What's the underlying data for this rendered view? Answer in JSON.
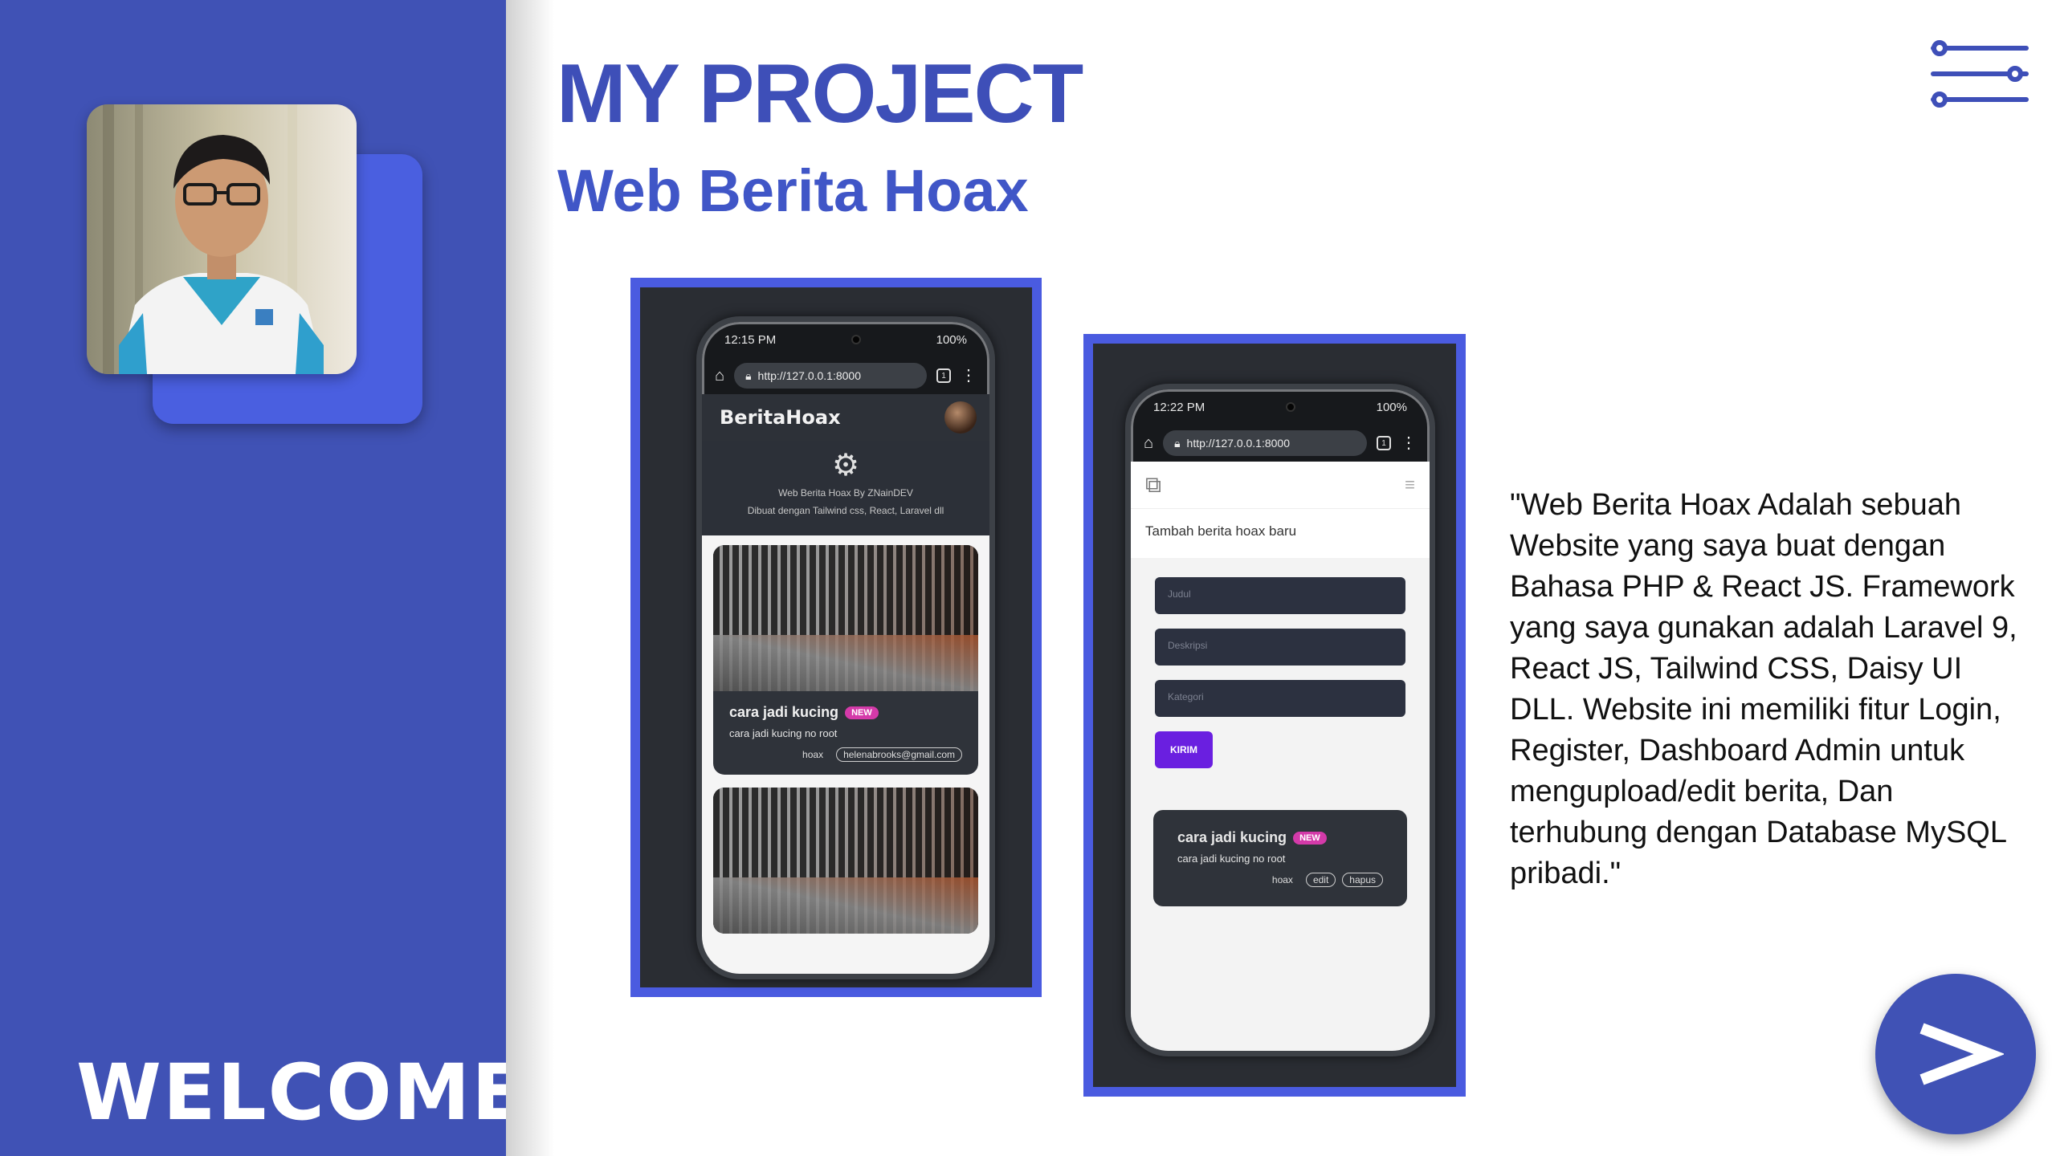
{
  "sidebar": {
    "welcome": "WELCOME"
  },
  "header": {
    "title": "MY PROJECT",
    "subtitle": "Web Berita Hoax"
  },
  "menu_icon": "sliders-menu-icon",
  "next_button_label": ">",
  "description": "\"Web Berita Hoax Adalah sebuah Website yang saya buat dengan Bahasa PHP & React JS. Framework yang saya gunakan adalah Laravel 9, React JS, Tailwind CSS, Daisy UI DLL. Website ini memiliki fitur Login, Register, Dashboard Admin untuk mengupload/edit berita, Dan terhubung dengan Database MySQL pribadi.\"",
  "phone1": {
    "time": "12:15 PM",
    "battery": "100%",
    "url": "http://127.0.0.1:8000",
    "tab_count": "1",
    "brand": "BeritaHoax",
    "hero_line1": "Web Berita Hoax By ZNainDEV",
    "hero_line2": "Dibuat dengan Tailwind css, React, Laravel dll",
    "card": {
      "title": "cara jadi kucing",
      "badge": "NEW",
      "desc": "cara jadi kucing no root",
      "tag1": "hoax",
      "tag2": "helenabrooks@gmail.com"
    }
  },
  "phone2": {
    "time": "12:22 PM",
    "battery": "100%",
    "url": "http://127.0.0.1:8000",
    "tab_count": "1",
    "heading": "Tambah berita hoax baru",
    "placeholders": {
      "judul": "Judul",
      "deskripsi": "Deskripsi",
      "kategori": "Kategori"
    },
    "submit": "KIRIM",
    "card": {
      "title": "cara jadi kucing",
      "badge": "NEW",
      "desc": "cara jadi kucing no root",
      "tag1": "hoax",
      "tag2": "edit",
      "tag3": "hapus"
    }
  },
  "colors": {
    "sidebar": "#4052b5",
    "accent": "#4a5be0",
    "title": "#3e4fb8",
    "badge": "#d43aa9",
    "submit": "#6a1fe0"
  }
}
